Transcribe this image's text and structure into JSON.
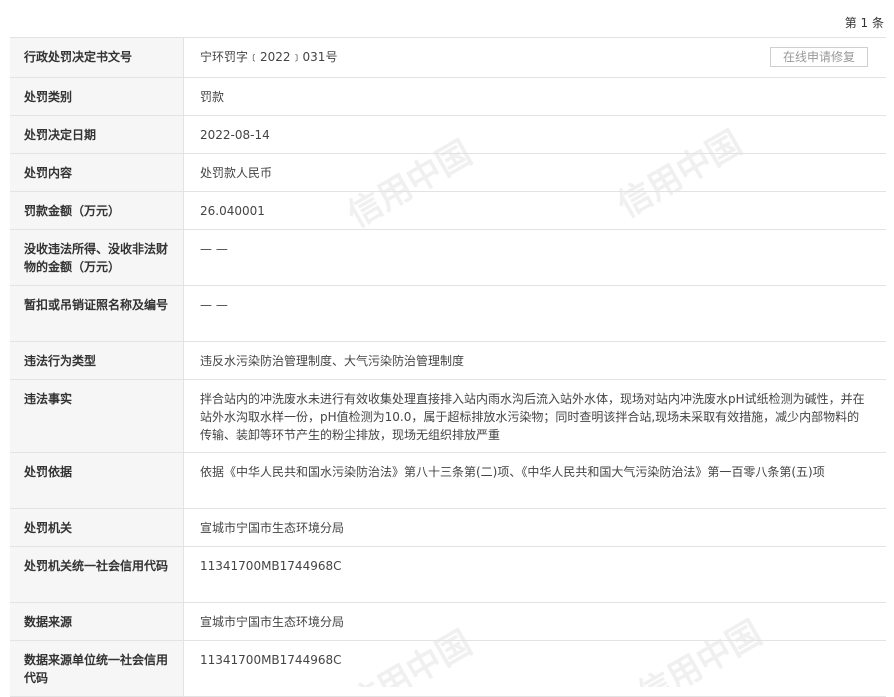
{
  "page": {
    "count": "第 1 条"
  },
  "repair_button": "在线申请修复",
  "watermark": "信用中国",
  "rows": [
    {
      "label": "行政处罚决定书文号",
      "value": "宁环罚字﹝2022﹞031号"
    },
    {
      "label": "处罚类别",
      "value": "罚款"
    },
    {
      "label": "处罚决定日期",
      "value": "2022-08-14"
    },
    {
      "label": "处罚内容",
      "value": "处罚款人民币"
    },
    {
      "label": "罚款金额（万元）",
      "value": "26.040001"
    },
    {
      "label": "没收违法所得、没收非法财物的金额（万元）",
      "value": "— —"
    },
    {
      "label": "暂扣或吊销证照名称及编号",
      "value": "— —"
    },
    {
      "label": "违法行为类型",
      "value": "违反水污染防治管理制度、大气污染防治管理制度"
    },
    {
      "label": "违法事实",
      "value": "拌合站内的冲洗废水未进行有效收集处理直接排入站内雨水沟后流入站外水体，现场对站内冲洗废水pH试纸检测为碱性，并在站外水沟取水样一份，pH值检测为10.0，属于超标排放水污染物；同时查明该拌合站,现场未采取有效措施，减少内部物料的传输、装卸等环节产生的粉尘排放，现场无组织排放严重"
    },
    {
      "label": "处罚依据",
      "value": "依据《中华人民共和国水污染防治法》第八十三条第(二)项、《中华人民共和国大气污染防治法》第一百零八条第(五)项"
    },
    {
      "label": "处罚机关",
      "value": "宣城市宁国市生态环境分局"
    },
    {
      "label": "处罚机关统一社会信用代码",
      "value": "11341700MB1744968C"
    },
    {
      "label": "数据来源",
      "value": "宣城市宁国市生态环境分局"
    },
    {
      "label": "数据来源单位统一社会信用代码",
      "value": "11341700MB1744968C"
    }
  ]
}
